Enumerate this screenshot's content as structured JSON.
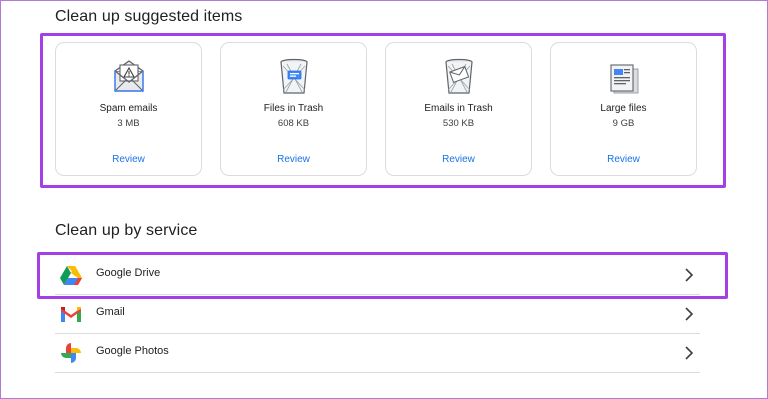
{
  "suggested": {
    "title": "Clean up suggested items",
    "items": [
      {
        "label": "Spam emails",
        "size": "3 MB",
        "action": "Review",
        "icon": "spam-mail-icon"
      },
      {
        "label": "Files in Trash",
        "size": "608 KB",
        "action": "Review",
        "icon": "trash-files-icon"
      },
      {
        "label": "Emails in Trash",
        "size": "530 KB",
        "action": "Review",
        "icon": "trash-emails-icon"
      },
      {
        "label": "Large files",
        "size": "9 GB",
        "action": "Review",
        "icon": "large-files-icon"
      }
    ]
  },
  "by_service": {
    "title": "Clean up by service",
    "items": [
      {
        "label": "Google Drive",
        "icon": "google-drive-icon"
      },
      {
        "label": "Gmail",
        "icon": "gmail-icon"
      },
      {
        "label": "Google Photos",
        "icon": "google-photos-icon"
      }
    ]
  },
  "colors": {
    "highlight": "#a43ee6",
    "link": "#1a73e8",
    "border": "#dadce0"
  }
}
